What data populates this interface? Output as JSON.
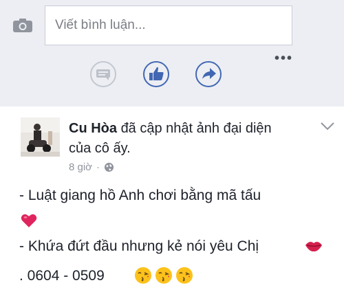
{
  "composer": {
    "placeholder": "Viết bình luận...",
    "camera_icon": "camera-icon",
    "more_label": "•••"
  },
  "actions": {
    "comment_icon": "comment-icon",
    "like_icon": "thumbs-up-icon",
    "share_icon": "share-arrow-icon"
  },
  "post": {
    "author": "Cu Hòa",
    "action_text": "đã cập nhật ảnh đại diện của cô ấy.",
    "time": "8 giờ",
    "separator": "·",
    "privacy_icon": "globe-icon",
    "lines": [
      "- Luật giang hồ Anh chơi bằng mã tấu",
      "- Khứa đứt đầu nhưng kẻ nói yêu Chị",
      ". 0604 - 0509"
    ]
  },
  "colors": {
    "accent": "#4267b2",
    "icon_gray": "#90949c",
    "heart_red": "#e0245e",
    "background_top": "#eceef3"
  }
}
